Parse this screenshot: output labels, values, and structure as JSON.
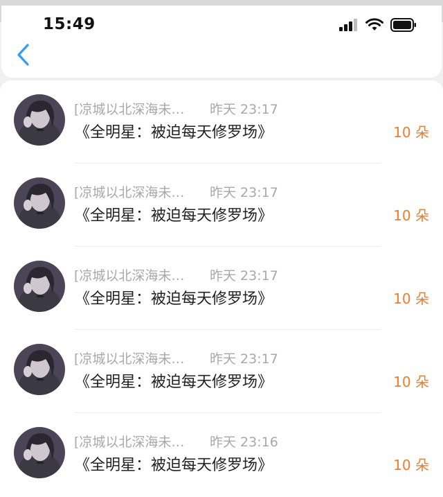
{
  "status_bar": {
    "time": "15:49",
    "signal_icon": "cellular-signal-icon",
    "wifi_icon": "wifi-icon",
    "battery_icon": "battery-icon"
  },
  "nav": {
    "back_icon": "chevron-left-icon",
    "accent_color": "#2e9df5"
  },
  "rows": [
    {
      "sender": "[凉城以北深海未…",
      "time": "昨天 23:17",
      "book": "《全明星：被迫每天修罗场》",
      "amount": "10 朵"
    },
    {
      "sender": "[凉城以北深海未…",
      "time": "昨天 23:17",
      "book": "《全明星：被迫每天修罗场》",
      "amount": "10 朵"
    },
    {
      "sender": "[凉城以北深海未…",
      "time": "昨天 23:17",
      "book": "《全明星：被迫每天修罗场》",
      "amount": "10 朵"
    },
    {
      "sender": "[凉城以北深海未…",
      "time": "昨天 23:17",
      "book": "《全明星：被迫每天修罗场》",
      "amount": "10 朵"
    },
    {
      "sender": "[凉城以北深海未…",
      "time": "昨天 23:16",
      "book": "《全明星：被迫每天修罗场》",
      "amount": "10 朵"
    }
  ],
  "colors": {
    "amount": "#f07c2b",
    "meta": "#a8a8a8",
    "title": "#222222"
  }
}
